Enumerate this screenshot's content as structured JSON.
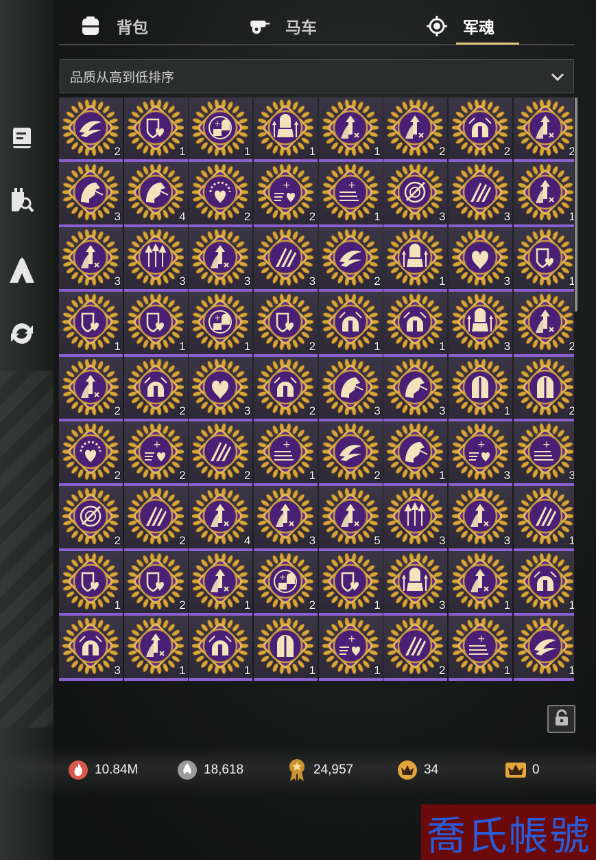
{
  "tabs": [
    {
      "label": "背包",
      "icon": "backpack-icon",
      "active": false
    },
    {
      "label": "马车",
      "icon": "carriage-icon",
      "active": false
    },
    {
      "label": "军魂",
      "icon": "soul-icon",
      "active": true
    }
  ],
  "side_nav": [
    {
      "icon": "scroll-icon"
    },
    {
      "icon": "tower-search-icon"
    },
    {
      "icon": "tent-icon"
    },
    {
      "icon": "refresh-icon"
    }
  ],
  "sort": {
    "label": "品质从高到低排序"
  },
  "items": [
    {
      "glyph": "wings",
      "count": "2"
    },
    {
      "glyph": "shield-heart",
      "count": "1"
    },
    {
      "glyph": "helmet-plus",
      "count": "1"
    },
    {
      "glyph": "soldier-arrows",
      "count": "1"
    },
    {
      "glyph": "arrow-up",
      "count": "1"
    },
    {
      "glyph": "arrow-up",
      "count": "2"
    },
    {
      "glyph": "helmet",
      "count": "2"
    },
    {
      "glyph": "arrow-up",
      "count": "2"
    },
    {
      "glyph": "horse",
      "count": "3"
    },
    {
      "glyph": "horse",
      "count": "4"
    },
    {
      "glyph": "sun-heart",
      "count": "2"
    },
    {
      "glyph": "plus-heart",
      "count": "2"
    },
    {
      "glyph": "plus-lines",
      "count": "1"
    },
    {
      "glyph": "target",
      "count": "3"
    },
    {
      "glyph": "claws",
      "count": "3"
    },
    {
      "glyph": "arrow-up",
      "count": "1"
    },
    {
      "glyph": "arrow-up",
      "count": "3"
    },
    {
      "glyph": "arrows",
      "count": "3"
    },
    {
      "glyph": "arrow-up",
      "count": "3"
    },
    {
      "glyph": "claws",
      "count": "3"
    },
    {
      "glyph": "wings",
      "count": "2"
    },
    {
      "glyph": "soldier-arrows",
      "count": "1"
    },
    {
      "glyph": "heart",
      "count": "3"
    },
    {
      "glyph": "shield-heart",
      "count": "1"
    },
    {
      "glyph": "shield-heart",
      "count": "1"
    },
    {
      "glyph": "shield-heart",
      "count": "1"
    },
    {
      "glyph": "helmet-plus",
      "count": "1"
    },
    {
      "glyph": "shield-heart",
      "count": "2"
    },
    {
      "glyph": "helmet",
      "count": "1"
    },
    {
      "glyph": "helmet",
      "count": "1"
    },
    {
      "glyph": "soldier-arrows",
      "count": "3"
    },
    {
      "glyph": "arrow-up",
      "count": "2"
    },
    {
      "glyph": "arrow-up",
      "count": "2"
    },
    {
      "glyph": "helmet",
      "count": "2"
    },
    {
      "glyph": "heart",
      "count": "3"
    },
    {
      "glyph": "helmet",
      "count": "2"
    },
    {
      "glyph": "horse",
      "count": "3"
    },
    {
      "glyph": "horse",
      "count": "3"
    },
    {
      "glyph": "gate",
      "count": "1"
    },
    {
      "glyph": "gate",
      "count": "2"
    },
    {
      "glyph": "sun-heart",
      "count": "2"
    },
    {
      "glyph": "plus-heart",
      "count": "2"
    },
    {
      "glyph": "claws",
      "count": "2"
    },
    {
      "glyph": "plus-lines",
      "count": "1"
    },
    {
      "glyph": "wings",
      "count": "2"
    },
    {
      "glyph": "horse",
      "count": "1"
    },
    {
      "glyph": "plus-heart",
      "count": "3"
    },
    {
      "glyph": "plus-lines",
      "count": "3"
    },
    {
      "glyph": "target",
      "count": "2"
    },
    {
      "glyph": "claws",
      "count": "2"
    },
    {
      "glyph": "arrow-up",
      "count": "4"
    },
    {
      "glyph": "arrow-up",
      "count": "3"
    },
    {
      "glyph": "arrow-up",
      "count": "5"
    },
    {
      "glyph": "arrows",
      "count": "3"
    },
    {
      "glyph": "arrow-up",
      "count": "3"
    },
    {
      "glyph": "claws",
      "count": "1"
    },
    {
      "glyph": "shield-heart",
      "count": "1"
    },
    {
      "glyph": "shield-heart",
      "count": "2"
    },
    {
      "glyph": "arrow-up",
      "count": "1"
    },
    {
      "glyph": "helmet-plus",
      "count": "2"
    },
    {
      "glyph": "shield-heart",
      "count": "1"
    },
    {
      "glyph": "soldier-arrows",
      "count": "3"
    },
    {
      "glyph": "arrow-up",
      "count": "1"
    },
    {
      "glyph": "helmet",
      "count": "1"
    },
    {
      "glyph": "helmet",
      "count": "3"
    },
    {
      "glyph": "arrow-up",
      "count": "1"
    },
    {
      "glyph": "helmet",
      "count": "1"
    },
    {
      "glyph": "gate",
      "count": "1"
    },
    {
      "glyph": "plus-heart",
      "count": "1"
    },
    {
      "glyph": "claws",
      "count": "2"
    },
    {
      "glyph": "plus-lines",
      "count": "1"
    },
    {
      "glyph": "wings",
      "count": "1"
    }
  ],
  "currencies": [
    {
      "icon": "flame-icon",
      "value": "10.84M",
      "color": "#d9584b"
    },
    {
      "icon": "spade-flame-icon",
      "value": "18,618",
      "color": "#9a9a9a"
    },
    {
      "icon": "medal-icon",
      "value": "24,957",
      "color": "#c9922f"
    },
    {
      "icon": "crown-coin-icon",
      "value": "34",
      "color": "#e2a63b"
    },
    {
      "icon": "crown-icon",
      "value": "0",
      "color": "#e2a63b"
    }
  ],
  "watermark": "喬氏帳號",
  "colors": {
    "accent": "#e3c67a",
    "cell_border": "#8c5fd0",
    "medal_purple": "#5a2a8c",
    "medal_gold": "#d6a53b"
  }
}
